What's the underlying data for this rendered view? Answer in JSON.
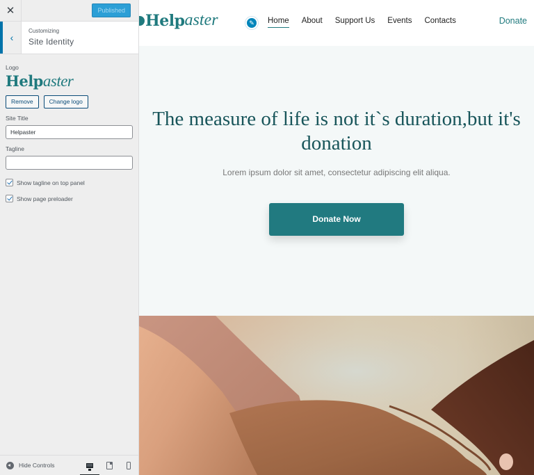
{
  "customizer": {
    "close_icon": "close-icon",
    "publish_label": "Published",
    "back_icon": "chevron-left-icon",
    "breadcrumb_label": "Customizing",
    "section_title": "Site Identity",
    "logo": {
      "label": "Logo",
      "preview_bold": "Help",
      "preview_italic": "aster",
      "remove_label": "Remove",
      "change_label": "Change logo"
    },
    "site_title": {
      "label": "Site Title",
      "value": "Helpaster"
    },
    "tagline": {
      "label": "Tagline",
      "value": ""
    },
    "checkboxes": [
      {
        "label": "Show tagline on top panel",
        "checked": true
      },
      {
        "label": "Show page preloader",
        "checked": true
      }
    ],
    "footer": {
      "hide_controls_label": "Hide Controls",
      "devices": [
        "desktop",
        "tablet",
        "mobile"
      ],
      "active_device": "desktop"
    }
  },
  "site": {
    "logo_bold": "Help",
    "logo_italic": "aster",
    "nav": [
      {
        "label": "Home",
        "active": true
      },
      {
        "label": "About",
        "active": false
      },
      {
        "label": "Support Us",
        "active": false
      },
      {
        "label": "Events",
        "active": false
      },
      {
        "label": "Contacts",
        "active": false
      }
    ],
    "donate_link": "Donate",
    "hero": {
      "title": "The measure of life is not it`s duration,but it's donation",
      "text": "Lorem ipsum dolor sit amet, consectetur adipiscing elit aliqua.",
      "cta": "Donate Now"
    },
    "photo_alt": "Hands resting on another person's hand"
  },
  "colors": {
    "brand_teal": "#207a7e",
    "wp_blue": "#0073aa",
    "publish_blue": "#2c9fd6",
    "hero_bg": "#f4f8f8"
  }
}
